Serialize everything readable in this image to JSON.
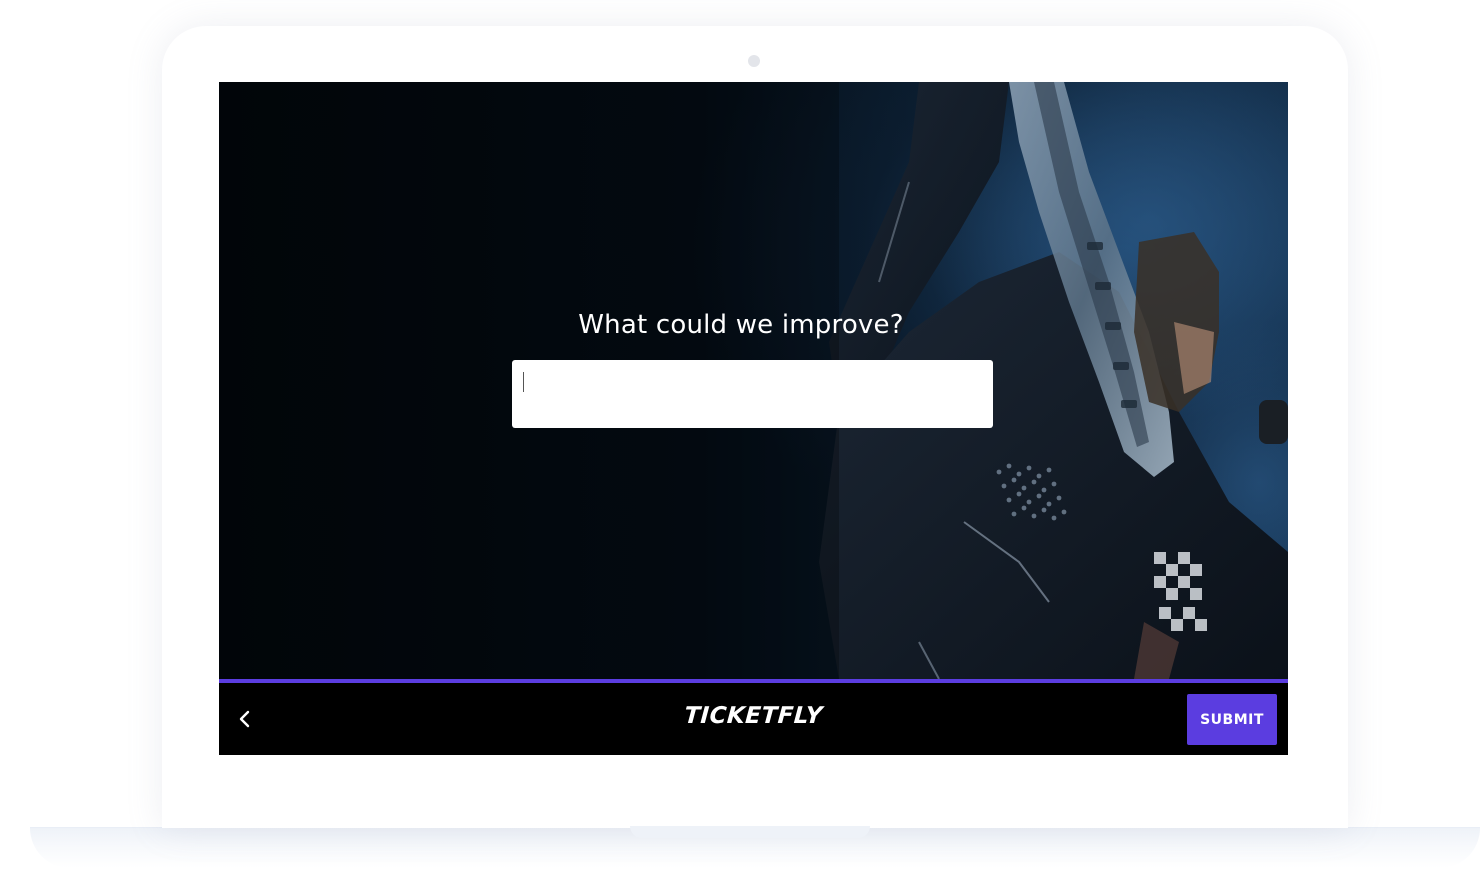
{
  "survey": {
    "question": "What could we improve?",
    "answer_value": "",
    "progress_percent": 100
  },
  "footer": {
    "brand": "TICKETFLY",
    "submit_label": "SUBMIT"
  },
  "icons": {
    "back": "chevron-left-icon",
    "camera": "camera-dot"
  },
  "colors": {
    "accent": "#5b3de0",
    "footer_background": "#000000",
    "hero_background": "#020609"
  }
}
